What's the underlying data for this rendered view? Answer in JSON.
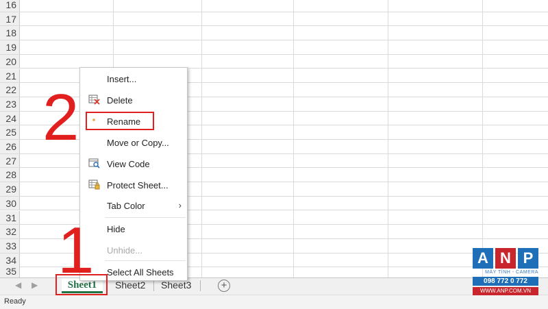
{
  "grid": {
    "row_numbers": [
      "16",
      "17",
      "18",
      "19",
      "20",
      "21",
      "22",
      "23",
      "24",
      "25",
      "26",
      "27",
      "28",
      "29",
      "30",
      "31",
      "32",
      "33",
      "34",
      "35"
    ]
  },
  "context_menu": {
    "items": [
      {
        "label": "Insert...",
        "icon": ""
      },
      {
        "label": "Delete",
        "icon": "delete-sheet-icon"
      },
      {
        "label": "Rename",
        "icon": "rename-dot-icon"
      },
      {
        "label": "Move or Copy...",
        "icon": ""
      },
      {
        "label": "View Code",
        "icon": "view-code-icon"
      },
      {
        "label": "Protect Sheet...",
        "icon": "protect-sheet-icon"
      },
      {
        "label": "Tab Color",
        "icon": "",
        "submenu": true
      },
      {
        "label": "Hide",
        "icon": ""
      },
      {
        "label": "Unhide...",
        "icon": "",
        "disabled": true
      },
      {
        "label": "Select All Sheets",
        "icon": ""
      }
    ]
  },
  "sheet_tabs": [
    "Sheet1",
    "Sheet2",
    "Sheet3"
  ],
  "status_bar": {
    "text": "Ready"
  },
  "annotations": {
    "step1": "1",
    "step2": "2",
    "color": "#e11f1f"
  },
  "watermark": {
    "letters": [
      "A",
      "N",
      "P"
    ],
    "subtitle": "MÁY TÍNH - CAMERA",
    "phone": "098 772 0 772",
    "url": "WWW.ANP.COM.VN"
  },
  "colors": {
    "excel_green": "#217346",
    "anp_blue": "#1e6fb8",
    "anp_red": "#c8252c"
  }
}
